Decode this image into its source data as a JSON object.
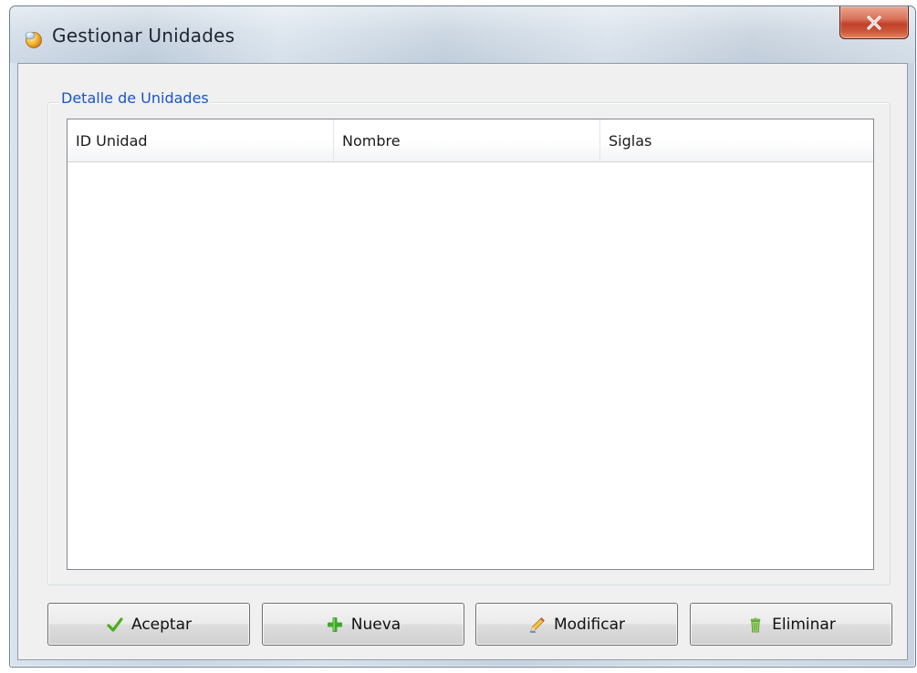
{
  "window": {
    "title": "Gestionar Unidades",
    "close_glyph": "X",
    "icon": "app-icon"
  },
  "group": {
    "title": "Detalle de Unidades"
  },
  "table": {
    "columns": [
      "ID Unidad",
      "Nombre",
      "Siglas"
    ],
    "rows": []
  },
  "buttons": {
    "aceptar": {
      "label": "Aceptar",
      "icon": "check-icon"
    },
    "nueva": {
      "label": "Nueva",
      "icon": "plus-icon"
    },
    "modificar": {
      "label": "Modificar",
      "icon": "pencil-icon"
    },
    "eliminar": {
      "label": "Eliminar",
      "icon": "trash-icon"
    }
  },
  "colors": {
    "group_title": "#1a55c8",
    "close_button": "#c1412a",
    "check": "#4caf1a",
    "plus": "#3fa82b"
  }
}
